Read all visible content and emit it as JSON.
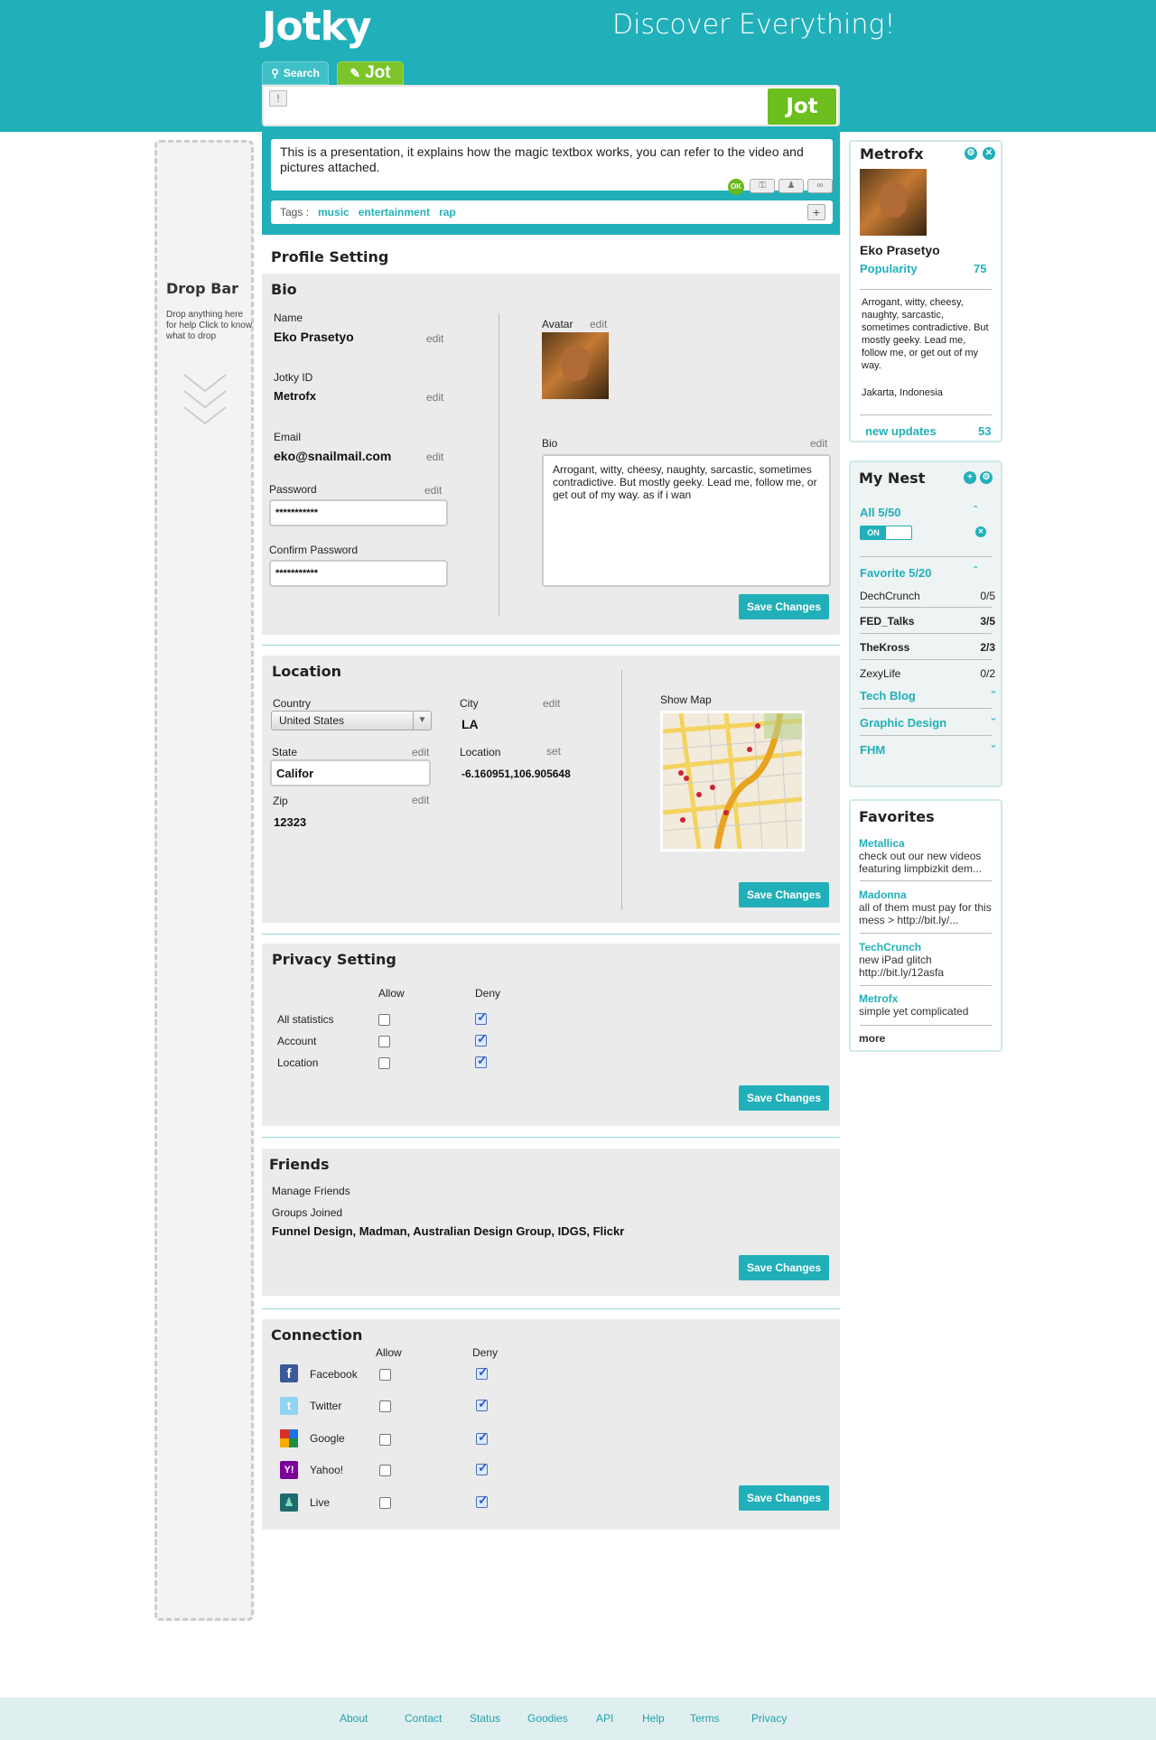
{
  "header": {
    "logo": "Jotky",
    "tagline": "Discover Everything!",
    "tab_search": "Search",
    "tab_jot": "Jot",
    "bang": "!",
    "jot_button": "Jot"
  },
  "dropbar": {
    "title": "Drop Bar",
    "help": "Drop anything here for help Click to know what to drop"
  },
  "magic": {
    "text": "This is a presentation, it explains how the magic textbox works, you can refer to the video and pictures attached.",
    "ok": "OK",
    "tags_label": "Tags :",
    "tags": [
      "music",
      "entertainment",
      "rap"
    ]
  },
  "profile_title": "Profile Setting",
  "bio_section": {
    "title": "Bio",
    "name_label": "Name",
    "name": "Eko Prasetyo",
    "jotky_id_label": "Jotky ID",
    "jotky_id": "Metrofx",
    "email_label": "Email",
    "email": "eko@snailmail.com",
    "password_label": "Password",
    "password": "***********",
    "confirm_label": "Confirm Password",
    "confirm": "***********",
    "avatar_label": "Avatar",
    "bio_label": "Bio",
    "bio": "Arrogant, witty, cheesy, naughty, sarcastic, sometimes contradictive. But mostly geeky. Lead me, follow me, or get out of my way. as if i wan",
    "edit": "edit",
    "save": "Save Changes"
  },
  "location_section": {
    "title": "Location",
    "country_label": "Country",
    "country": "United States",
    "city_label": "City",
    "city": "LA",
    "state_label": "State",
    "state": "Califor",
    "location_label": "Location",
    "location": "-6.160951,106.905648",
    "set": "set",
    "zip_label": "Zip",
    "zip": "12323",
    "map_label": "Show Map",
    "edit": "edit",
    "save": "Save Changes"
  },
  "privacy_section": {
    "title": "Privacy Setting",
    "allow": "Allow",
    "deny": "Deny",
    "rows": [
      "All statistics",
      "Account",
      "Location"
    ],
    "save": "Save Changes"
  },
  "friends_section": {
    "title": "Friends",
    "manage": "Manage Friends",
    "groups_label": "Groups Joined",
    "groups": "Funnel Design, Madman, Australian Design Group, IDGS, Flickr",
    "save": "Save Changes"
  },
  "connection_section": {
    "title": "Connection",
    "allow": "Allow",
    "deny": "Deny",
    "rows": [
      "Facebook",
      "Twitter",
      "Google",
      "Yahoo!",
      "Live"
    ],
    "save": "Save Changes"
  },
  "profile_card": {
    "username": "Metrofx",
    "name": "Eko Prasetyo",
    "popularity_label": "Popularity",
    "popularity": "75",
    "bio": "Arrogant, witty, cheesy, naughty, sarcastic, sometimes contradictive. But mostly geeky. Lead me, follow me, or get out of my way.",
    "location": "Jakarta, Indonesia",
    "updates_label": "new updates",
    "updates": "53"
  },
  "nest": {
    "title": "My Nest",
    "all_label": "All  5/50",
    "toggle": "ON",
    "favorite_label": "Favorite  5/20",
    "items": [
      {
        "name": "DechCrunch",
        "count": "0/5"
      },
      {
        "name": "FED_Talks",
        "count": "3/5"
      },
      {
        "name": "TheKross",
        "count": "2/3"
      },
      {
        "name": "ZexyLife",
        "count": "0/2"
      }
    ],
    "groups": [
      "Tech Blog",
      "Graphic Design",
      "FHM"
    ]
  },
  "favorites": {
    "title": "Favorites",
    "items": [
      {
        "name": "Metallica",
        "text": "check out our new videos featuring limpbizkit dem..."
      },
      {
        "name": "Madonna",
        "text": "all of them must pay for this mess > http://bit.ly/..."
      },
      {
        "name": "TechCrunch",
        "text": "new iPad glitch http://bit.ly/12asfa"
      },
      {
        "name": "Metrofx",
        "text": "simple yet complicated"
      }
    ],
    "more": "more"
  },
  "footer": [
    "About",
    "Contact",
    "Status",
    "Goodies",
    "API",
    "Help",
    "Terms",
    "Privacy"
  ]
}
